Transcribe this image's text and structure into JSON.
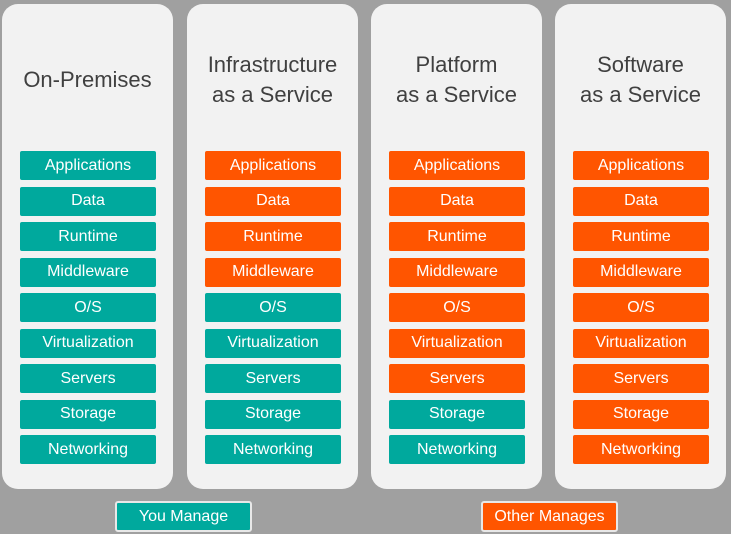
{
  "colors": {
    "you_manage": "#00a99d",
    "other_manages": "#ff5500",
    "background": "#a0a0a0",
    "panel": "#f2f2f2"
  },
  "layers": [
    "Applications",
    "Data",
    "Runtime",
    "Middleware",
    "O/S",
    "Virtualization",
    "Servers",
    "Storage",
    "Networking"
  ],
  "columns": [
    {
      "title": "On-Premises",
      "you_manage_count": 9
    },
    {
      "title": "Infrastructure\nas a Service",
      "you_manage_count": 5
    },
    {
      "title": "Platform\nas a Service",
      "you_manage_count": 2
    },
    {
      "title": "Software\nas a Service",
      "you_manage_count": 0
    }
  ],
  "legend": {
    "you_manage": "You Manage",
    "other_manages": "Other Manages"
  }
}
